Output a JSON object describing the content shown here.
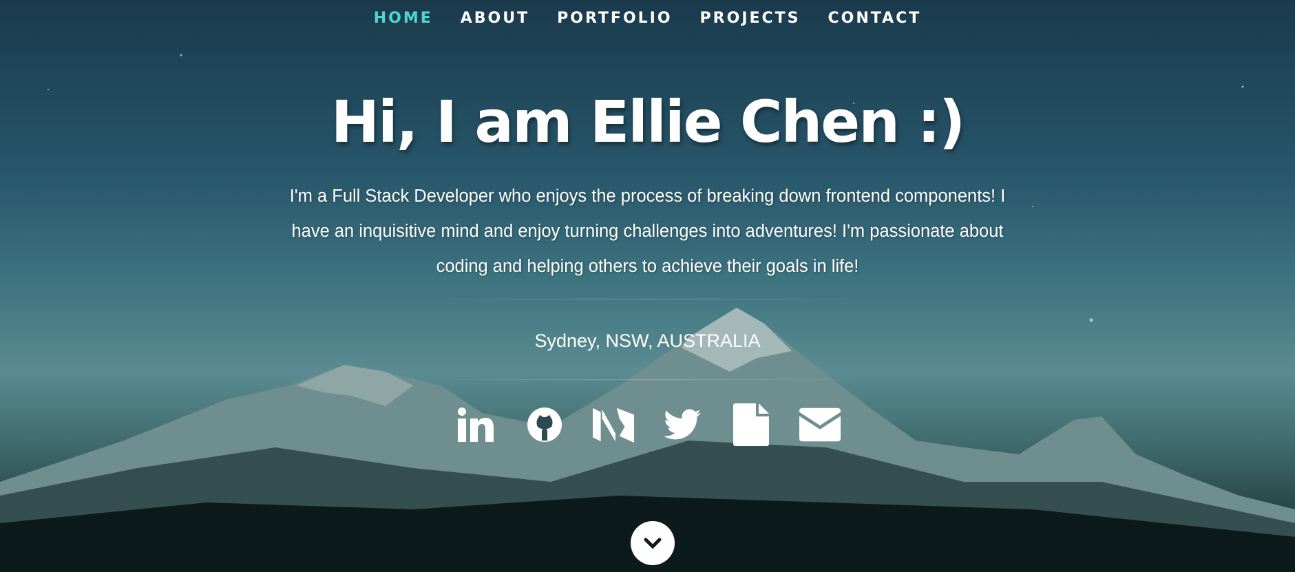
{
  "nav": {
    "items": [
      {
        "label": "HOME",
        "active": true
      },
      {
        "label": "ABOUT"
      },
      {
        "label": "PORTFOLIO"
      },
      {
        "label": "PROJECTS"
      },
      {
        "label": "CONTACT"
      }
    ]
  },
  "hero": {
    "title": "Hi, I am Ellie Chen :)",
    "bio": "I'm a Full Stack Developer who enjoys the process of breaking down frontend components! I have an inquisitive mind and enjoy turning challenges into adventures! I'm passionate about coding and helping others to achieve their goals in life!",
    "location": "Sydney, NSW, AUSTRALIA"
  },
  "social": [
    "linkedin-icon",
    "github-icon",
    "medium-icon",
    "twitter-icon",
    "resume-file-icon",
    "email-icon"
  ],
  "colors": {
    "accent": "#4fd6d0",
    "text": "#ffffff"
  }
}
